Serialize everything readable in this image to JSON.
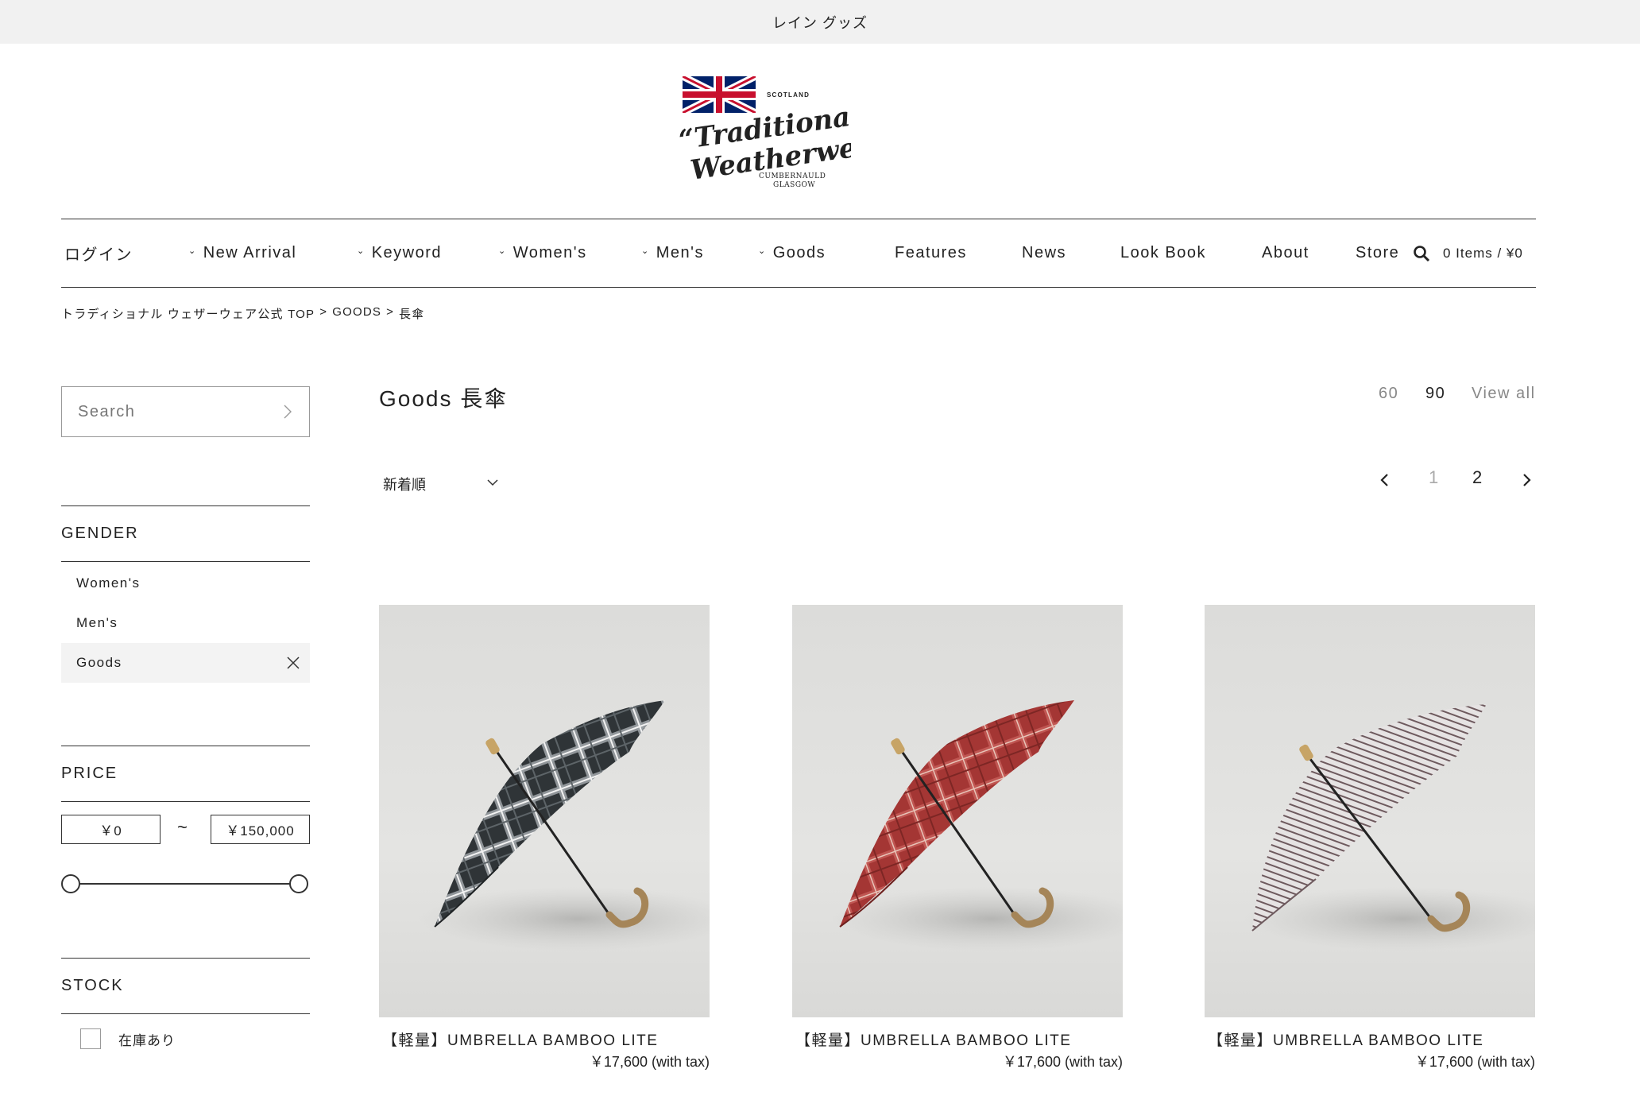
{
  "announcement": "レイン グッズ",
  "brand": {
    "logo_top": "SCOTLAND",
    "logo_line1": "“Traditional",
    "logo_line2": "Weatherwear”",
    "logo_sub1": "CUMBERNAULD",
    "logo_sub2": "GLASGOW"
  },
  "nav": {
    "login": "ログイン",
    "new_arrival": "New Arrival",
    "keyword": "Keyword",
    "womens": "Women's",
    "mens": "Men's",
    "goods": "Goods",
    "features": "Features",
    "news": "News",
    "lookbook": "Look Book",
    "about": "About",
    "store": "Store",
    "cart": "0 Items / ¥0"
  },
  "breadcrumb": {
    "home": "トラディショナル ウェザーウェア公式 TOP",
    "sep1": ">",
    "category": "GOODS",
    "sep2": ">",
    "current": "長傘"
  },
  "sidebar": {
    "search_placeholder": "Search",
    "gender_title": "GENDER",
    "gender_options": [
      "Women's",
      "Men's",
      "Goods"
    ],
    "price_title": "PRICE",
    "price_min": "￥0",
    "price_max": "￥150,000",
    "price_sep": "~",
    "price_range_fraction": [
      0,
      1
    ],
    "stock_title": "STOCK",
    "stock_option": "在庫あり"
  },
  "listing": {
    "title": "Goods 長傘",
    "per_page": [
      "60",
      "90",
      "View all"
    ],
    "sort_label": "新着順",
    "pages": [
      "1",
      "2"
    ]
  },
  "products": [
    {
      "name": "【軽量】UMBRELLA BAMBOO LITE",
      "price": "￥17,600 (with tax)",
      "pattern": "black-white-tartan"
    },
    {
      "name": "【軽量】UMBRELLA BAMBOO LITE",
      "price": "￥17,600 (with tax)",
      "pattern": "red-tartan"
    },
    {
      "name": "【軽量】UMBRELLA BAMBOO LITE",
      "price": "￥17,600 (with tax)",
      "pattern": "grey-pinstripe"
    }
  ],
  "colors": {
    "flag_red": "#c8102e",
    "flag_blue": "#012169"
  }
}
